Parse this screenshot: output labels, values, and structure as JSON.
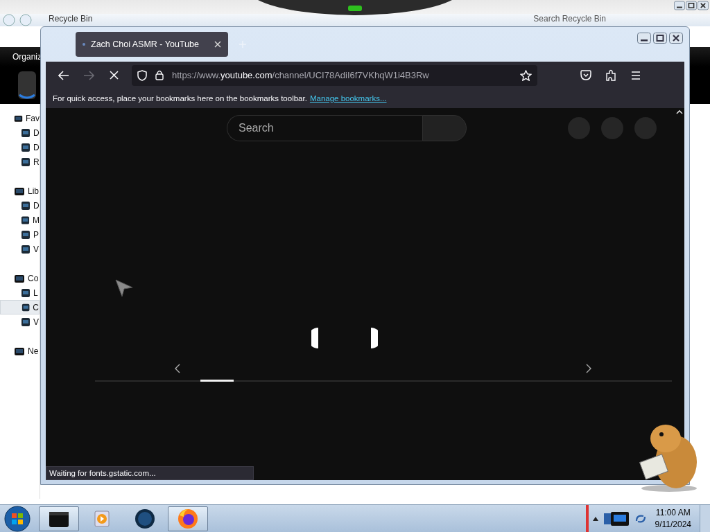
{
  "explorer": {
    "address": "Recycle Bin",
    "search_placeholder": "Search Recycle Bin",
    "toolbar": [
      "Organiz"
    ],
    "sidebar": [
      {
        "label": "Fav",
        "children": [
          {
            "label": "D",
            "selected": false
          },
          {
            "label": "D",
            "selected": false
          },
          {
            "label": "R",
            "selected": false
          }
        ]
      },
      {
        "label": "Lib",
        "children": [
          {
            "label": "D",
            "selected": false
          },
          {
            "label": "M",
            "selected": false
          },
          {
            "label": "P",
            "selected": false
          },
          {
            "label": "V",
            "selected": false
          }
        ]
      },
      {
        "label": "Co",
        "children": [
          {
            "label": "L",
            "selected": false
          },
          {
            "label": "C",
            "selected": true
          },
          {
            "label": "V",
            "selected": false
          }
        ]
      },
      {
        "label": "Ne"
      }
    ]
  },
  "browser": {
    "tabs": [
      {
        "title": "Zach Choi ASMR - YouTube",
        "selected": true
      }
    ],
    "url": {
      "prefix": "https://www.",
      "host": "youtube.com",
      "path": "/channel/UCI78AdiI6f7VKhqW1i4B3Rw"
    },
    "bookmarks_hint": "For quick access, place your bookmarks here on the bookmarks toolbar.",
    "bookmarks_link": "Manage bookmarks...",
    "page": {
      "search_placeholder": "Search"
    },
    "status": "Waiting for fonts.gstatic.com..."
  },
  "taskbar": {
    "items": [
      {
        "kind": "explorer",
        "selected": true
      },
      {
        "kind": "media",
        "selected": false
      },
      {
        "kind": "globe",
        "selected": false
      },
      {
        "kind": "firefox",
        "selected": true
      }
    ],
    "time": "11:00 AM",
    "date": "9/11/2024"
  }
}
